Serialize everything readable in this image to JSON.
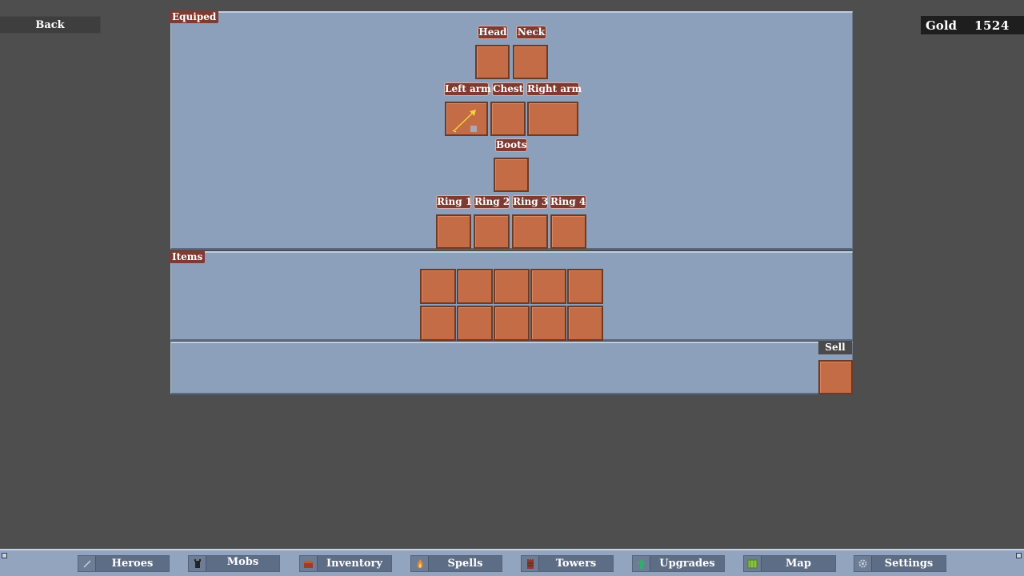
{
  "header": {
    "back_label": "Back",
    "gold_label": "Gold",
    "gold_value": "1524"
  },
  "equipped": {
    "title": "Equiped",
    "slots": {
      "head": "Head",
      "neck": "Neck",
      "left_arm": "Left arm",
      "chest": "Chest",
      "right_arm": "Right arm",
      "boots": "Boots",
      "ring1": "Ring 1",
      "ring2": "Ring 2",
      "ring3": "Ring 3",
      "ring4": "Ring 4"
    },
    "left_arm_item_icon": "arrow-icon"
  },
  "items": {
    "title": "Items"
  },
  "sell": {
    "label": "Sell"
  },
  "nav": {
    "heroes": "Heroes",
    "mobs": "Mobs",
    "inventory": "Inventory",
    "spells": "Spells",
    "towers": "Towers",
    "upgrades": "Upgrades",
    "map": "Map",
    "settings": "Settings"
  },
  "colors": {
    "background": "#4e4e4e",
    "panel": "#8c9fbb",
    "slot": "#c36c45",
    "label": "#7d3b32",
    "accent_gold": "#f2d33a"
  }
}
